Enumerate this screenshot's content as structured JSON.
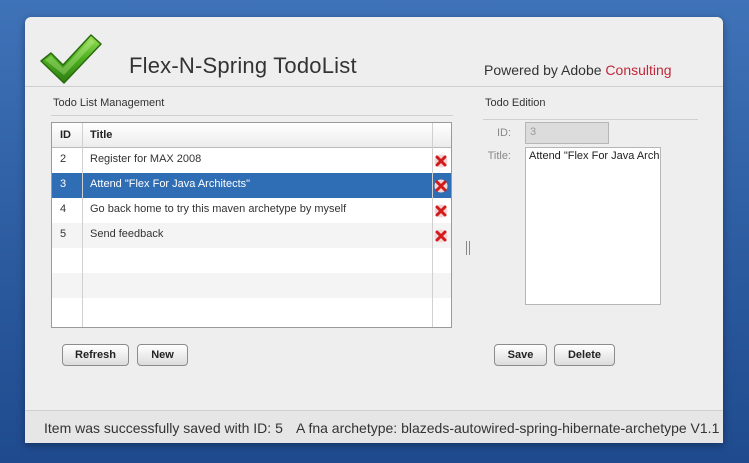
{
  "header": {
    "title": "Flex-N-Spring TodoList",
    "powered_prefix": "Powered by Adobe",
    "powered_accent": "Consulting",
    "accent_color": "#c0283b",
    "logo_icon": "green-checkmark-icon"
  },
  "list_panel": {
    "title": "Todo List Management",
    "columns": {
      "id": "ID",
      "title": "Title"
    },
    "rows": [
      {
        "id": "2",
        "title": "Register for MAX 2008",
        "selected": false
      },
      {
        "id": "3",
        "title": "Attend \"Flex For Java Architects\"",
        "selected": true
      },
      {
        "id": "4",
        "title": "Go back home to try this maven archetype by myself",
        "selected": false
      },
      {
        "id": "5",
        "title": "Send feedback",
        "selected": false
      }
    ],
    "delete_icon": "red-x-delete-icon",
    "refresh_label": "Refresh",
    "new_label": "New",
    "selection_color": "#2f6db5"
  },
  "edit_panel": {
    "title": "Todo Edition",
    "id_label": "ID:",
    "id_value": "3",
    "title_label": "Title:",
    "title_value": "Attend \"Flex For Java Architects\"",
    "save_label": "Save",
    "delete_label": "Delete"
  },
  "status": {
    "message": "Item was successfully saved with ID: 5",
    "archetype": "A fna archetype: blazeds-autowired-spring-hibernate-archetype V1.1"
  }
}
